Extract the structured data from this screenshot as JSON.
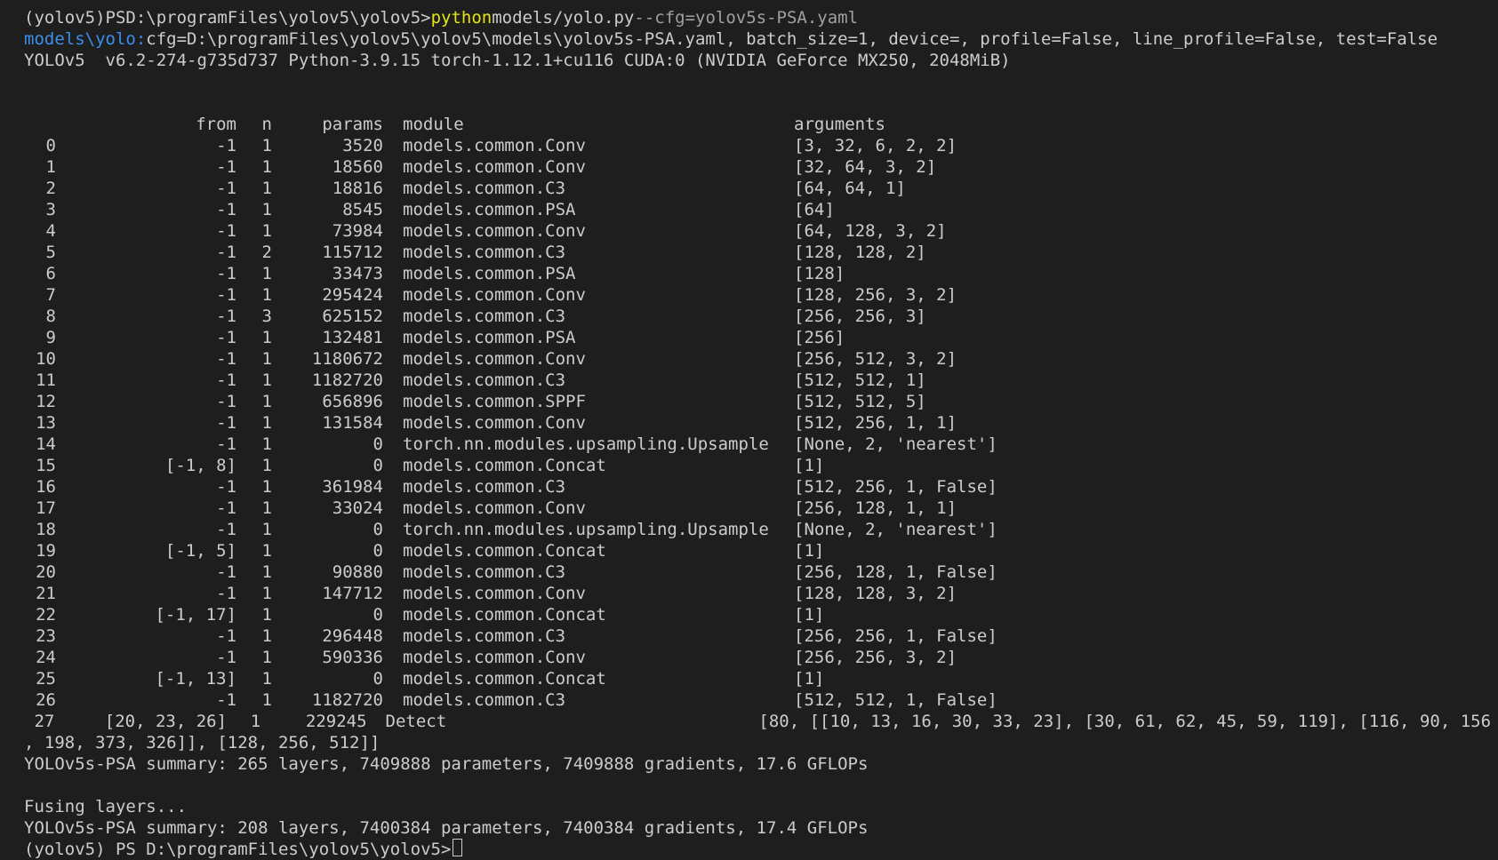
{
  "prompt": {
    "env": "(yolov5)",
    "ps": "PS",
    "cwd": "D:\\programFiles\\yolov5\\yolov5>",
    "cmd_exe": "python",
    "cmd_script": "models/yolo.py",
    "cmd_arg": "--cfg=yolov5s-PSA.yaml"
  },
  "cfg_line": {
    "prefix": "models\\yolo:",
    "text": "cfg=D:\\programFiles\\yolov5\\yolov5\\models\\yolov5s-PSA.yaml, batch_size=1, device=, profile=False, line_profile=False, test=False"
  },
  "env_line": "YOLOv5  v6.2-274-g735d737 Python-3.9.15 torch-1.12.1+cu116 CUDA:0 (NVIDIA GeForce MX250, 2048MiB)",
  "table": {
    "headers": {
      "idx": "",
      "from": "from",
      "n": "n",
      "params": "params",
      "module": "module",
      "args": "arguments"
    },
    "rows": [
      {
        "idx": "0",
        "from": "-1",
        "n": "1",
        "params": "3520",
        "module": "models.common.Conv",
        "args": "[3, 32, 6, 2, 2]"
      },
      {
        "idx": "1",
        "from": "-1",
        "n": "1",
        "params": "18560",
        "module": "models.common.Conv",
        "args": "[32, 64, 3, 2]"
      },
      {
        "idx": "2",
        "from": "-1",
        "n": "1",
        "params": "18816",
        "module": "models.common.C3",
        "args": "[64, 64, 1]"
      },
      {
        "idx": "3",
        "from": "-1",
        "n": "1",
        "params": "8545",
        "module": "models.common.PSA",
        "args": "[64]"
      },
      {
        "idx": "4",
        "from": "-1",
        "n": "1",
        "params": "73984",
        "module": "models.common.Conv",
        "args": "[64, 128, 3, 2]"
      },
      {
        "idx": "5",
        "from": "-1",
        "n": "2",
        "params": "115712",
        "module": "models.common.C3",
        "args": "[128, 128, 2]"
      },
      {
        "idx": "6",
        "from": "-1",
        "n": "1",
        "params": "33473",
        "module": "models.common.PSA",
        "args": "[128]"
      },
      {
        "idx": "7",
        "from": "-1",
        "n": "1",
        "params": "295424",
        "module": "models.common.Conv",
        "args": "[128, 256, 3, 2]"
      },
      {
        "idx": "8",
        "from": "-1",
        "n": "3",
        "params": "625152",
        "module": "models.common.C3",
        "args": "[256, 256, 3]"
      },
      {
        "idx": "9",
        "from": "-1",
        "n": "1",
        "params": "132481",
        "module": "models.common.PSA",
        "args": "[256]"
      },
      {
        "idx": "10",
        "from": "-1",
        "n": "1",
        "params": "1180672",
        "module": "models.common.Conv",
        "args": "[256, 512, 3, 2]"
      },
      {
        "idx": "11",
        "from": "-1",
        "n": "1",
        "params": "1182720",
        "module": "models.common.C3",
        "args": "[512, 512, 1]"
      },
      {
        "idx": "12",
        "from": "-1",
        "n": "1",
        "params": "656896",
        "module": "models.common.SPPF",
        "args": "[512, 512, 5]"
      },
      {
        "idx": "13",
        "from": "-1",
        "n": "1",
        "params": "131584",
        "module": "models.common.Conv",
        "args": "[512, 256, 1, 1]"
      },
      {
        "idx": "14",
        "from": "-1",
        "n": "1",
        "params": "0",
        "module": "torch.nn.modules.upsampling.Upsample",
        "args": "[None, 2, 'nearest']"
      },
      {
        "idx": "15",
        "from": "[-1, 8]",
        "n": "1",
        "params": "0",
        "module": "models.common.Concat",
        "args": "[1]"
      },
      {
        "idx": "16",
        "from": "-1",
        "n": "1",
        "params": "361984",
        "module": "models.common.C3",
        "args": "[512, 256, 1, False]"
      },
      {
        "idx": "17",
        "from": "-1",
        "n": "1",
        "params": "33024",
        "module": "models.common.Conv",
        "args": "[256, 128, 1, 1]"
      },
      {
        "idx": "18",
        "from": "-1",
        "n": "1",
        "params": "0",
        "module": "torch.nn.modules.upsampling.Upsample",
        "args": "[None, 2, 'nearest']"
      },
      {
        "idx": "19",
        "from": "[-1, 5]",
        "n": "1",
        "params": "0",
        "module": "models.common.Concat",
        "args": "[1]"
      },
      {
        "idx": "20",
        "from": "-1",
        "n": "1",
        "params": "90880",
        "module": "models.common.C3",
        "args": "[256, 128, 1, False]"
      },
      {
        "idx": "21",
        "from": "-1",
        "n": "1",
        "params": "147712",
        "module": "models.common.Conv",
        "args": "[128, 128, 3, 2]"
      },
      {
        "idx": "22",
        "from": "[-1, 17]",
        "n": "1",
        "params": "0",
        "module": "models.common.Concat",
        "args": "[1]"
      },
      {
        "idx": "23",
        "from": "-1",
        "n": "1",
        "params": "296448",
        "module": "models.common.C3",
        "args": "[256, 256, 1, False]"
      },
      {
        "idx": "24",
        "from": "-1",
        "n": "1",
        "params": "590336",
        "module": "models.common.Conv",
        "args": "[256, 256, 3, 2]"
      },
      {
        "idx": "25",
        "from": "[-1, 13]",
        "n": "1",
        "params": "0",
        "module": "models.common.Concat",
        "args": "[1]"
      },
      {
        "idx": "26",
        "from": "-1",
        "n": "1",
        "params": "1182720",
        "module": "models.common.C3",
        "args": "[512, 512, 1, False]"
      },
      {
        "idx": "27",
        "from": "[20, 23, 26]",
        "n": "1",
        "params": "229245",
        "module": "Detect",
        "args": "[80, [[10, 13, 16, 30, 33, 23], [30, 61, 62, 45, 59, 119], [116, 90, 156"
      }
    ],
    "wrap_line": ", 198, 373, 326]], [128, 256, 512]]"
  },
  "summary1": "YOLOv5s-PSA summary: 265 layers, 7409888 parameters, 7409888 gradients, 17.6 GFLOPs",
  "fusing": "Fusing layers...",
  "summary2": "YOLOv5s-PSA summary: 208 layers, 7400384 parameters, 7400384 gradients, 17.4 GFLOPs",
  "final_prompt": "(yolov5) PS D:\\programFiles\\yolov5\\yolov5>",
  "colors": {
    "background": "#1e1e1e",
    "text": "#cccccc",
    "keyword": "#e5e510",
    "arg": "#a0a0a0",
    "link": "#3b8eea"
  }
}
